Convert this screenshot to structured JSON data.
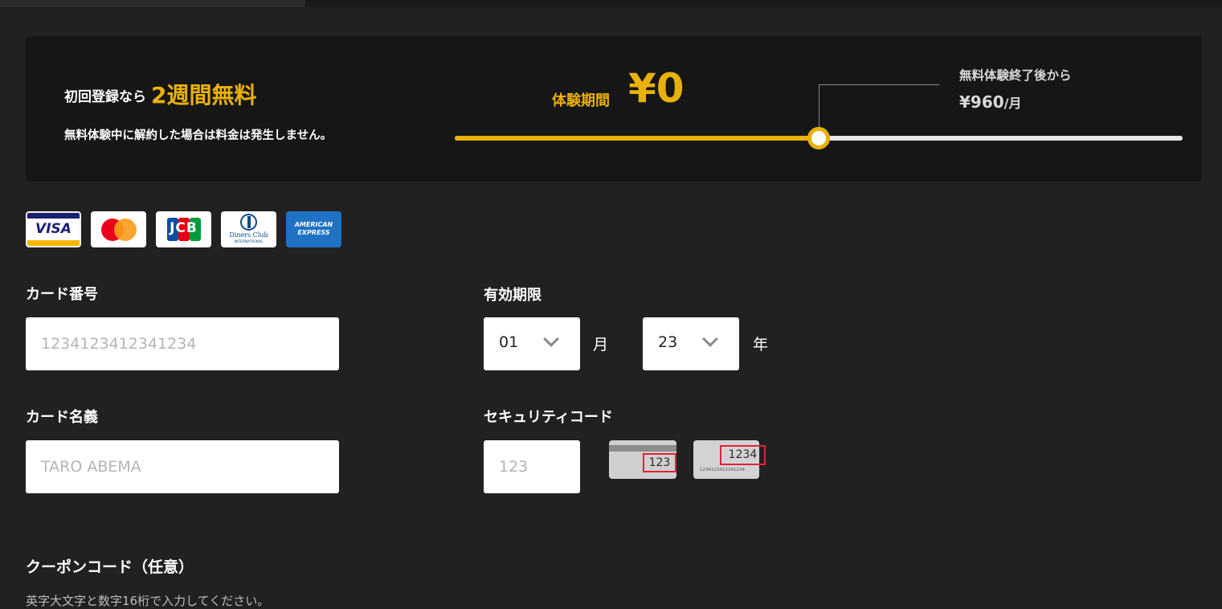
{
  "banner": {
    "headline_prefix": "初回登録なら",
    "headline_highlight": "2週間無料",
    "note": "無料体験中に解約した場合は料金は発生しません。",
    "trial_label": "体験期間",
    "trial_price": "¥0",
    "after_label": "無料体験終了後から",
    "after_price": "¥960",
    "after_unit": "/月",
    "slider_fraction": 0.5
  },
  "card_brands": {
    "visa": "VISA",
    "jcb": "JCB",
    "diners": "Diners Club",
    "diners_sub": "INTERNATIONAL",
    "amex_line1": "AMERICAN",
    "amex_line2": "EXPRESS"
  },
  "form": {
    "card_number": {
      "label": "カード番号",
      "placeholder": "1234123412341234",
      "value": ""
    },
    "expiry": {
      "label": "有効期限",
      "month_value": "01",
      "month_unit": "月",
      "year_value": "23",
      "year_unit": "年"
    },
    "card_name": {
      "label": "カード名義",
      "placeholder": "TARO ABEMA",
      "value": ""
    },
    "security_code": {
      "label": "セキュリティコード",
      "placeholder": "123",
      "value": "",
      "back_example": "123",
      "front_example": "1234",
      "front_number": "1234123412341234"
    },
    "coupon": {
      "label": "クーポンコード（任意）",
      "hint": "英字大文字と数字16桁で入力してください。"
    }
  },
  "colors": {
    "accent": "#e8b10a",
    "background": "#212121",
    "banner_background": "#161616",
    "security_highlight": "#e0233c"
  }
}
